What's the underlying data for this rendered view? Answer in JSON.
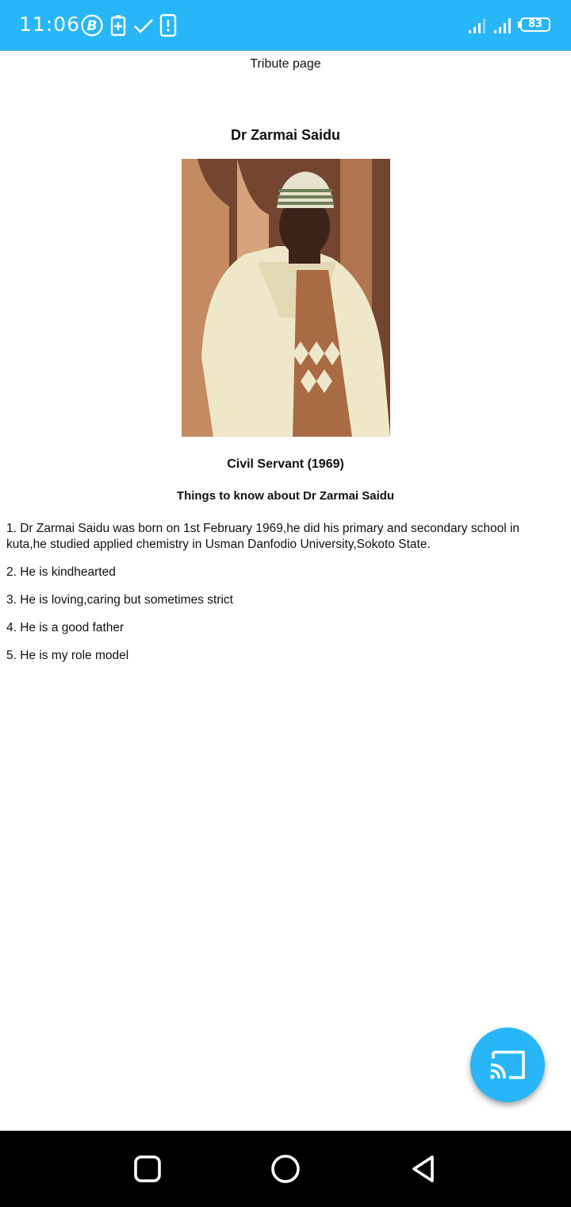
{
  "status_bar": {
    "time": "11:06",
    "battery_level": "83",
    "icons": [
      "bitcoin-icon",
      "battery-saver-icon",
      "check-icon",
      "phone-alert-icon",
      "signal-icon",
      "signal-icon"
    ],
    "background_color": "#29b6f6"
  },
  "page": {
    "header": "Tribute page",
    "name": "Dr Zarmai Saidu",
    "caption": "Civil Servant (1969)",
    "subheading": "Things to know about Dr Zarmai Saidu",
    "facts": [
      "1. Dr Zarmai Saidu was born on 1st February 1969,he did his primary and secondary school in kuta,he studied applied chemistry in Usman Danfodio University,Sokoto State.",
      "2. He is kindhearted",
      "3. He is loving,caring but sometimes strict",
      "4. He is a good father",
      "5. He is my role model"
    ]
  },
  "fab": {
    "icon": "cast-icon",
    "color": "#29b6f6"
  },
  "nav_bar": {
    "icons": [
      "recent-apps-icon",
      "home-icon",
      "back-icon"
    ]
  }
}
